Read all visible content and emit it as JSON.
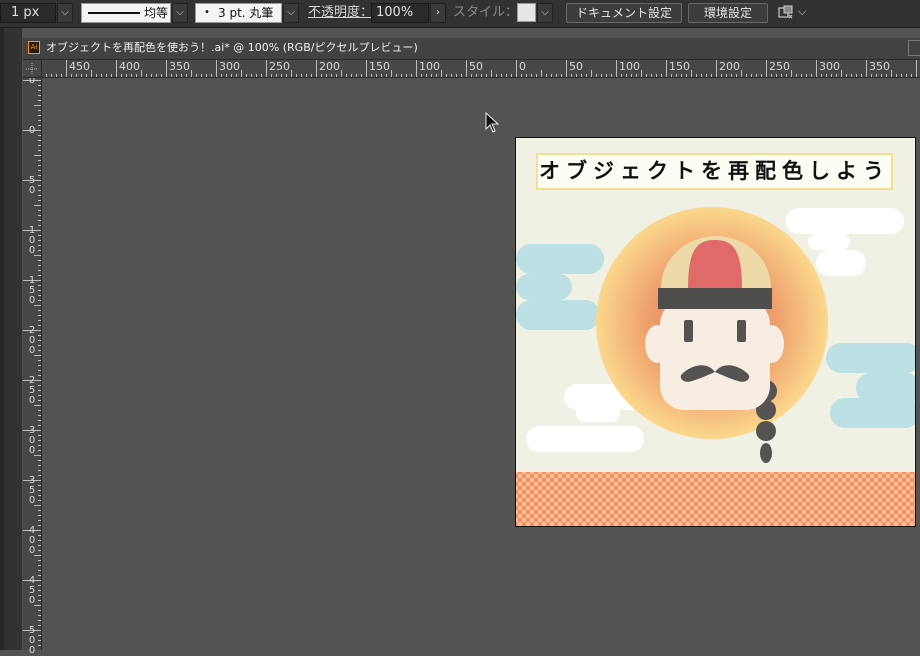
{
  "control_bar": {
    "stroke_weight": "1 px",
    "profile_label": "均等",
    "brush_label": "3 pt. 丸筆",
    "opacity_label": "不透明度：",
    "opacity_value": "100%",
    "style_label": "スタイル：",
    "doc_settings_button": "ドキュメント設定",
    "prefs_button": "環境設定"
  },
  "document": {
    "tab_title": "オブジェクトを再配色を使おう！.ai* @ 100% (RGB/ピクセルプレビュー)",
    "file_icon_label": "Ai"
  },
  "rulers": {
    "horizontal": [
      "450",
      "400",
      "350",
      "300",
      "250",
      "200",
      "150",
      "100",
      "50",
      "0",
      "50",
      "100",
      "150",
      "200",
      "250",
      "300",
      "350"
    ],
    "vertical": [
      "0",
      "0",
      "50",
      "100",
      "150",
      "200",
      "250",
      "300",
      "350",
      "400",
      "450",
      "500"
    ]
  },
  "artwork": {
    "title_text": "オブジェクトを再配色しよう",
    "colors": {
      "background": "#f1f0e4",
      "title_border": "#f2df8f",
      "halo_outer": "#f9d487",
      "halo_inner": "#e88d5c",
      "cloud_white": "#ffffff",
      "cloud_blue": "#bde0e4",
      "hat_red": "#e06a6a",
      "hat_cream": "#eed9a8",
      "hat_band": "#4f4d4b",
      "face": "#f8ede2",
      "mustache": "#555351",
      "pattern_base": "#f57d76",
      "pattern_dot": "#f7c383"
    }
  },
  "icons": {
    "cursor": "arrow-pointer-icon",
    "arrange": "arrange-documents-icon",
    "chevron": "chevron-down-icon"
  }
}
